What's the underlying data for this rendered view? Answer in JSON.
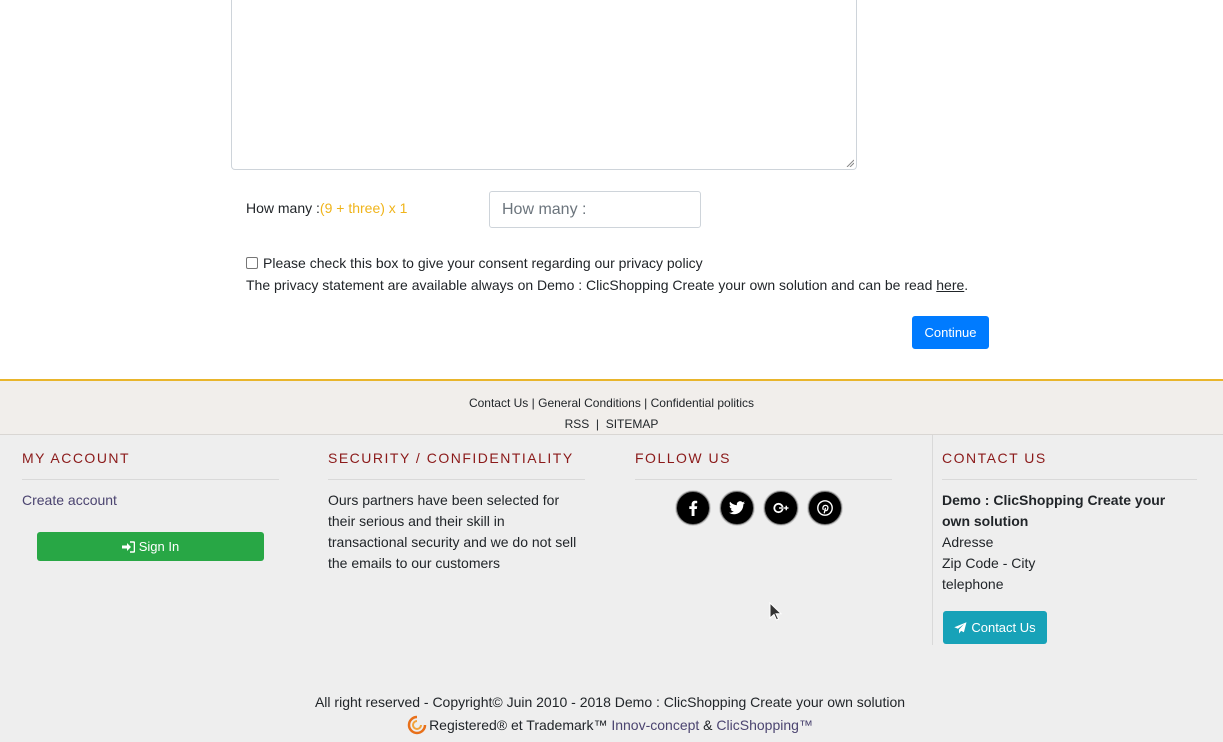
{
  "form": {
    "captcha_label": "How many :",
    "captcha_question": "(9 + three) x 1",
    "captcha_placeholder": "How many :",
    "consent_text": "Please check this box to give your consent regarding our privacy policy",
    "privacy_text": "The privacy statement are available always on Demo : ClicShopping Create your own solution and can be read ",
    "privacy_link": "here",
    "privacy_end": ".",
    "continue_label": "Continue"
  },
  "footer_links": {
    "contact": "Contact Us",
    "sep1": " | ",
    "conditions": "General Conditions",
    "sep2": " | ",
    "politics": "Confidential politics",
    "rss": "RSS",
    "sep3": "  |  ",
    "sitemap": "SITEMAP"
  },
  "account": {
    "title": "MY ACCOUNT",
    "create_label": "Create account",
    "signin_label": "Sign In"
  },
  "security": {
    "title": "SECURITY / CONFIDENTIALITY",
    "text": "Ours partners have been selected for their serious and their skill in transactional security and we do not sell the emails to our customers"
  },
  "follow": {
    "title": "FOLLOW US",
    "icons": [
      "facebook-icon",
      "twitter-icon",
      "google-plus-icon",
      "pinterest-icon"
    ]
  },
  "contact": {
    "title": "CONTACT US",
    "name": "Demo : ClicShopping Create your own solution",
    "address": "Adresse",
    "zip_city": "Zip Code - City",
    "telephone": "telephone",
    "button_label": "Contact Us"
  },
  "copyright": {
    "line1": "All right reserved - Copyright© Juin 2010 - 2018 Demo : ClicShopping Create your own solution",
    "registered": "Registered® et Trademark™ ",
    "innov": "Innov-concept",
    "amp": " & ",
    "clic": "ClicShopping™"
  },
  "colors": {
    "primary": "#007bff",
    "success": "#28a745",
    "info": "#17a2b8",
    "accent_rule": "#e9b52b",
    "heading": "#8b1a1a",
    "captcha_question": "#f0b41a"
  }
}
